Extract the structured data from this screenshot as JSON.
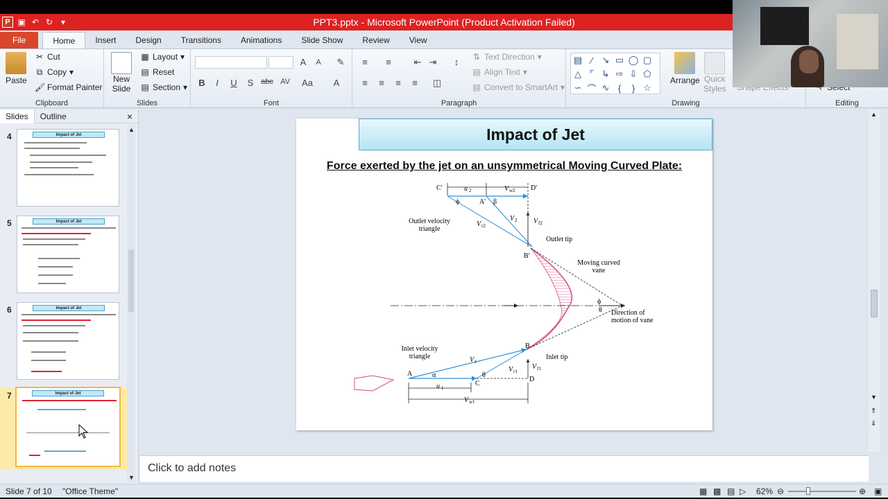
{
  "window": {
    "title": "PPT3.pptx - Microsoft PowerPoint (Product Activation Failed)"
  },
  "quick_access": {
    "app_icon_letter": "P"
  },
  "ribbon_tabs": [
    "File",
    "Home",
    "Insert",
    "Design",
    "Transitions",
    "Animations",
    "Slide Show",
    "Review",
    "View"
  ],
  "ribbon": {
    "clipboard": {
      "label": "Clipboard",
      "paste": "Paste",
      "cut": "Cut",
      "copy": "Copy",
      "format_painter": "Format Painter"
    },
    "slides": {
      "label": "Slides",
      "new_slide": "New",
      "new_slide2": "Slide",
      "layout": "Layout",
      "reset": "Reset",
      "section": "Section"
    },
    "font": {
      "label": "Font"
    },
    "paragraph": {
      "label": "Paragraph",
      "text_direction": "Text Direction",
      "align_text": "Align Text",
      "convert_smartart": "Convert to SmartArt"
    },
    "drawing": {
      "label": "Drawing",
      "arrange": "Arrange",
      "quick_styles": "Quick",
      "quick_styles2": "Styles",
      "shape_effects": "Shape Effects"
    },
    "editing": {
      "label": "Editing",
      "select": "Select"
    }
  },
  "pane": {
    "tab_slides": "Slides",
    "tab_outline": "Outline",
    "close": "×"
  },
  "thumbnails": [
    {
      "num": "4",
      "title": "Impact of Jet"
    },
    {
      "num": "5",
      "title": "Impact of Jet"
    },
    {
      "num": "6",
      "title": "Impact of Jet"
    },
    {
      "num": "7",
      "title": "Impact of Jet"
    }
  ],
  "slide": {
    "title": "Impact of Jet",
    "subtitle": "Force exerted by the jet on an unsymmetrical Moving Curved Plate:"
  },
  "diagram": {
    "labels": {
      "c_prime": "C'",
      "d_prime": "D'",
      "u2": "u",
      "u2_sub": "2",
      "vw2": "V",
      "vw2_sub": "w2",
      "a_prime": "A'",
      "phi": "ϕ",
      "beta": "β",
      "outlet_triangle": "Outlet velocity",
      "outlet_triangle2": "triangle",
      "vr2": "V",
      "vr2_sub": "r2",
      "v2": "V",
      "v2_sub": "2",
      "vf2": "V",
      "vf2_sub": "f2",
      "outlet_tip": "Outlet tip",
      "b_prime": "B'",
      "moving_vane": "Moving curved",
      "moving_vane2": "vane",
      "phi2": "ϕ",
      "theta2": "θ",
      "direction": "Direction of",
      "direction2": "motion of vane",
      "inlet_triangle": "Inlet velocity",
      "inlet_triangle2": "triangle",
      "v1": "V",
      "v1_sub": "1",
      "b": "B",
      "inlet_tip": "Inlet tip",
      "vr1": "V",
      "vr1_sub": "r1",
      "vf1": "V",
      "vf1_sub": "f1",
      "a": "A",
      "alpha": "α",
      "c": "C",
      "theta": "θ",
      "d": "D",
      "u1": "u",
      "u1_sub": "1",
      "vw1": "V",
      "vw1_sub": "w1"
    }
  },
  "notes": {
    "placeholder": "Click to add notes"
  },
  "status": {
    "slide_of": "Slide 7 of 10",
    "theme": "\"Office Theme\"",
    "zoom": "62%"
  }
}
